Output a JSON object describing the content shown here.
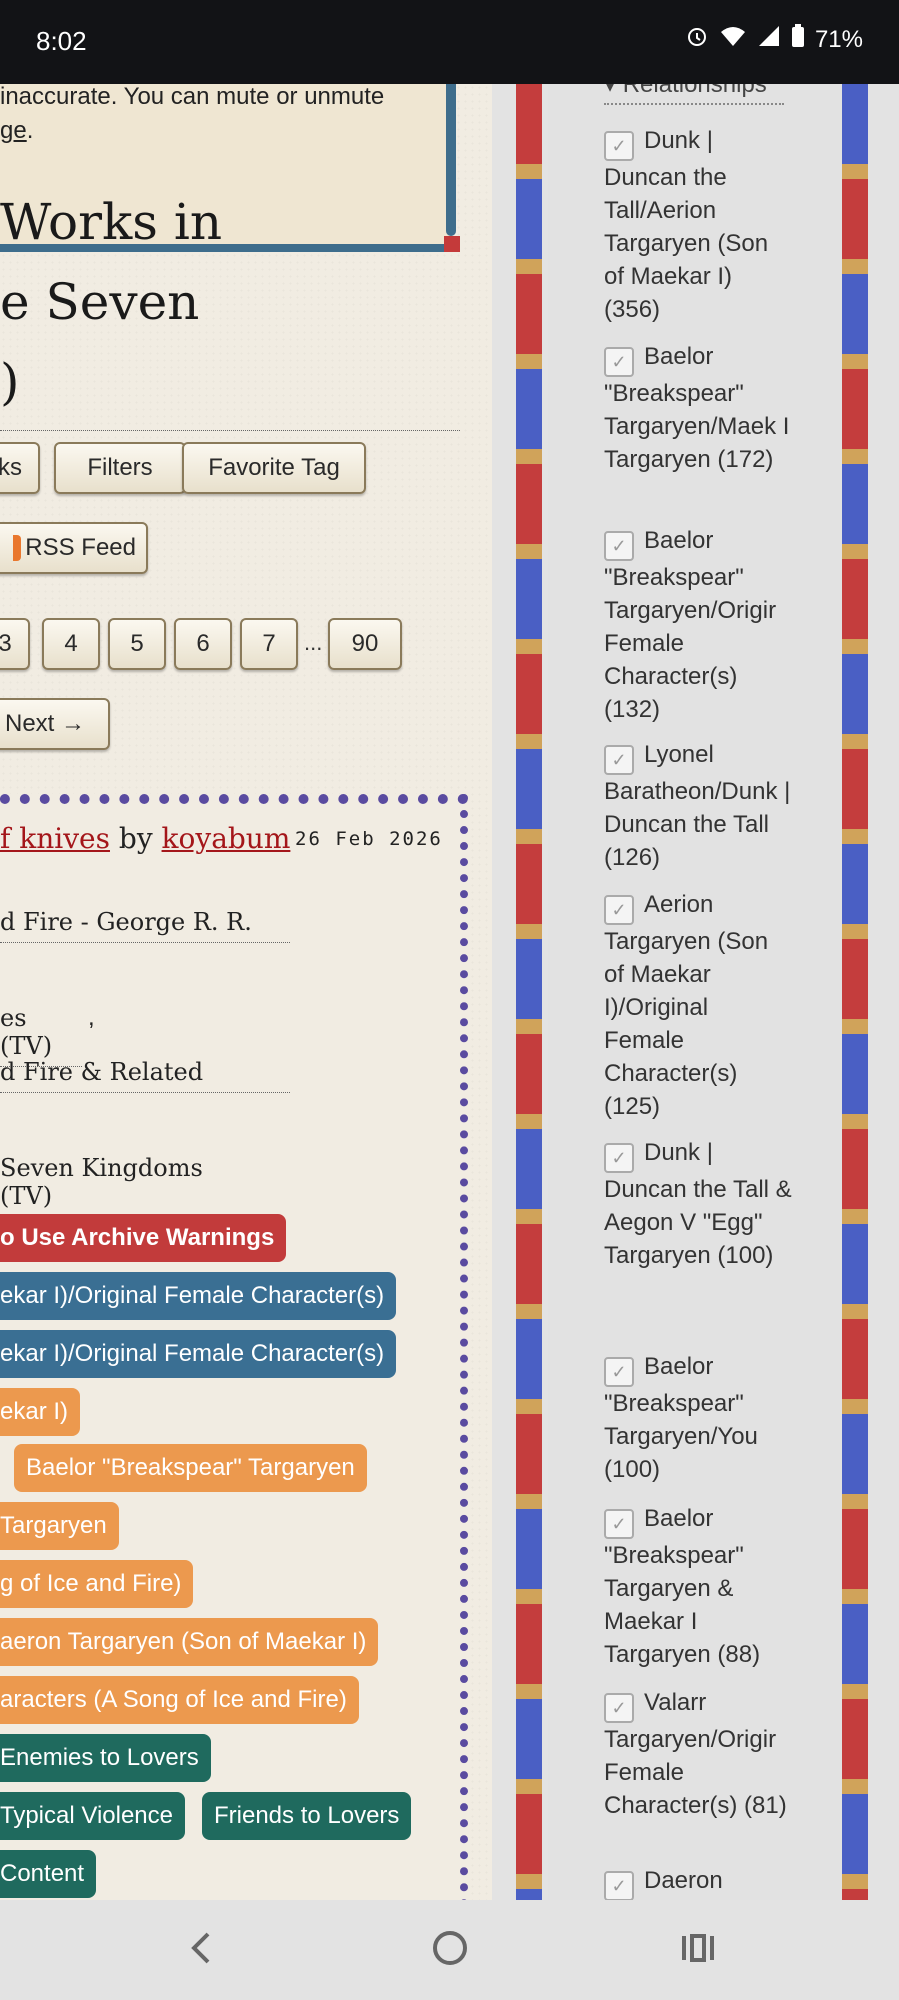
{
  "status_bar": {
    "time": "8:02",
    "battery": "71%"
  },
  "notice": {
    "line1": "inaccurate. You can mute or unmute",
    "line2_link": "ge",
    "line2_rest": "."
  },
  "page_heading": {
    "line1": "Works in",
    "line2": "e Seven",
    "line3": ")"
  },
  "buttons": {
    "works": "ks",
    "filters": "Filters",
    "favorite_tag": "Favorite Tag",
    "rss": "RSS Feed"
  },
  "pagination": {
    "pages": [
      "3",
      "4",
      "5",
      "6",
      "7"
    ],
    "ellipsis": "...",
    "last": "90",
    "next": "Next →"
  },
  "work": {
    "title_partial": "f knives",
    "by": "by",
    "author": "koyabum",
    "date": "26 Feb 2026",
    "fandoms": [
      "d Fire - George R. R.",
      "es (TV)",
      "d Fire & Related",
      "Seven Kingdoms (TV)"
    ],
    "fandom_sep": ",",
    "tags": [
      {
        "text": "o Use Archive Warnings",
        "color": "red"
      },
      {
        "text": "ekar I)/Original Female Character(s)",
        "color": "blue"
      },
      {
        "text": "ekar I)/Original Female Character(s)",
        "color": "blue"
      },
      {
        "text": "ekar I)",
        "color": "orange"
      },
      {
        "text": "Baelor \"Breakspear\" Targaryen",
        "color": "orange"
      },
      {
        "text": "Targaryen",
        "color": "orange"
      },
      {
        "text": "g of Ice and Fire)",
        "color": "orange"
      },
      {
        "text": "aeron Targaryen (Son of Maekar I)",
        "color": "orange"
      },
      {
        "text": "aracters (A Song of Ice and Fire)",
        "color": "orange"
      },
      {
        "text": "Enemies to Lovers",
        "color": "green"
      },
      {
        "text": "Typical Violence",
        "color": "green"
      },
      {
        "text": "Friends to Lovers",
        "color": "green"
      },
      {
        "text": "Content",
        "color": "green"
      }
    ]
  },
  "sidebar": {
    "header": "Relationships",
    "items": [
      "Dunk | Duncan the Tall/Aerion Targaryen (Son of Maekar I) (356)",
      "Baelor \"Breakspear\" Targaryen/Maek I Targaryen (172)",
      "Baelor \"Breakspear\" Targaryen/Origir Female Character(s) (132)",
      "Lyonel Baratheon/Dunk | Duncan the Tall (126)",
      "Aerion Targaryen (Son of Maekar I)/Original Female Character(s) (125)",
      "Dunk | Duncan the Tall & Aegon V \"Egg\" Targaryen (100)",
      "Baelor \"Breakspear\" Targaryen/You (100)",
      "Baelor \"Breakspear\" Targaryen & Maekar I Targaryen (88)",
      "Valarr Targaryen/Origir Female Character(s) (81)",
      "Daeron"
    ]
  },
  "colors": {
    "tag_red": "#c23b3b",
    "tag_blue": "#3a6f93",
    "tag_orange": "#ec994e",
    "tag_green": "#1f6a5e",
    "link": "#a4161a"
  },
  "nav_icons": [
    "back-icon",
    "home-icon",
    "recents-icon"
  ]
}
